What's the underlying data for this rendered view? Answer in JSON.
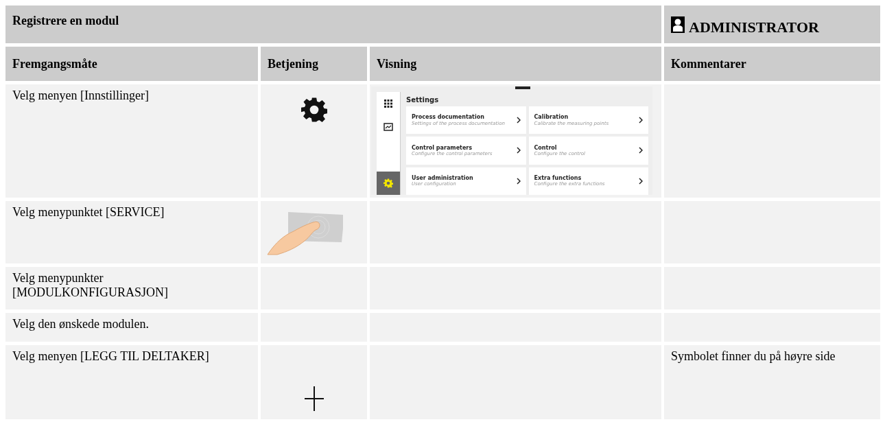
{
  "title": "Registrere en modul",
  "role": {
    "label": "ADMINISTRATOR"
  },
  "table": {
    "columns": [
      "Fremgangsmåte",
      "Betjening",
      "Visning",
      "Kommentarer"
    ],
    "rows": [
      {
        "step": "Velg menyen [Innstillinger]",
        "operation": {
          "kind": "gear"
        },
        "display": {
          "kind": "settings-screen"
        },
        "comment": ""
      },
      {
        "step": "Velg menypunktet [SERVICE]",
        "operation": {
          "kind": "touch"
        },
        "display": {
          "kind": "none"
        },
        "comment": ""
      },
      {
        "step": "Velg menypunkter [MODULKONFIGURASJON]",
        "operation": {
          "kind": "none"
        },
        "display": {
          "kind": "none"
        },
        "comment": ""
      },
      {
        "step": "Velg den ønskede modulen.",
        "operation": {
          "kind": "none"
        },
        "display": {
          "kind": "none"
        },
        "comment": ""
      },
      {
        "step": "Velg menyen [LEGG TIL DELTAKER]",
        "operation": {
          "kind": "plus"
        },
        "display": {
          "kind": "none"
        },
        "comment": "Symbolet finner du på høyre side"
      }
    ]
  },
  "settings_screen": {
    "title": "Settings",
    "sidebar": [
      {
        "kind": "grid",
        "selected": false
      },
      {
        "kind": "chart",
        "selected": false
      },
      {
        "kind": "gear",
        "selected": true
      }
    ],
    "tiles": [
      {
        "title": "Process documentation",
        "subtitle": "Settings of the process documentation"
      },
      {
        "title": "Calibration",
        "subtitle": "Calibrate the measuring points"
      },
      {
        "title": "Control parameters",
        "subtitle": "Configure the control parameters"
      },
      {
        "title": "Control",
        "subtitle": "Configure the control"
      },
      {
        "title": "User administration",
        "subtitle": "User configuration"
      },
      {
        "title": "Extra functions",
        "subtitle": "Configure the extra functions"
      }
    ]
  }
}
